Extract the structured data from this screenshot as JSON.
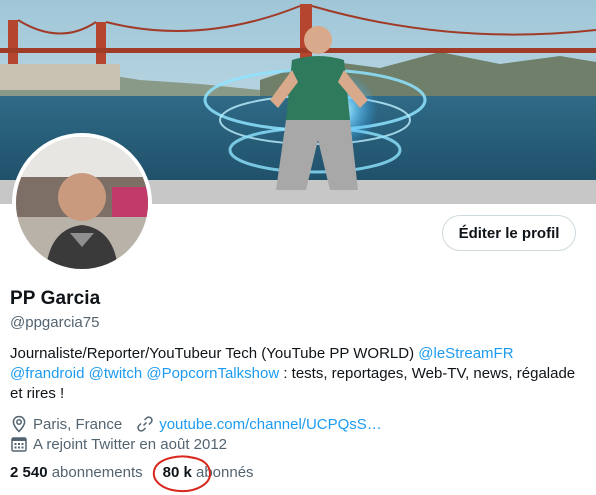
{
  "profile": {
    "name": "PP Garcia",
    "handle": "@ppgarcia75",
    "edit_button": "Éditer le profil"
  },
  "bio": {
    "part1": "Journaliste/Reporter/YouTubeur Tech (YouTube PP WORLD) ",
    "mention1": "@leStreamFR",
    "mention2": "@frandroid",
    "mention3": "@twitch",
    "mention4": "@PopcornTalkshow",
    "part2": " : tests, reportages, Web-TV, news, régalade et rires !"
  },
  "meta": {
    "location": "Paris, France",
    "website": "youtube.com/channel/UCPQsS…",
    "joined": "A rejoint Twitter en août 2012",
    "location_icon": "location-pin-icon",
    "link_icon": "link-icon",
    "calendar_icon": "calendar-icon"
  },
  "stats": {
    "following_count": "2 540",
    "following_label": "abonnements",
    "followers_count": "80 k",
    "followers_label": "abonnés"
  },
  "colors": {
    "link": "#1d9bf0",
    "secondary_text": "#536471",
    "annotation_circle": "#d9261c"
  }
}
